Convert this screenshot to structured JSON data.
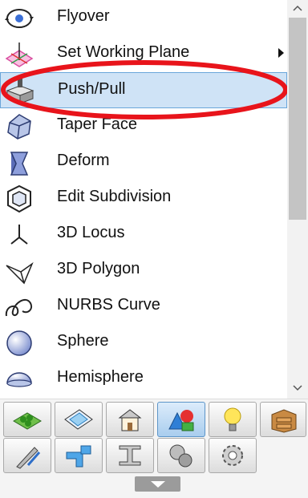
{
  "menu": {
    "items": [
      {
        "label": "Flyover",
        "icon": "flyover-icon"
      },
      {
        "label": "Set Working Plane",
        "icon": "working-plane-icon",
        "has_submenu": true
      },
      {
        "label": "Push/Pull",
        "icon": "push-pull-icon",
        "selected": true
      },
      {
        "label": "Taper Face",
        "icon": "taper-face-icon"
      },
      {
        "label": "Deform",
        "icon": "deform-icon"
      },
      {
        "label": "Edit Subdivision",
        "icon": "edit-subdivision-icon"
      },
      {
        "label": "3D Locus",
        "icon": "3d-locus-icon"
      },
      {
        "label": "3D Polygon",
        "icon": "3d-polygon-icon"
      },
      {
        "label": "NURBS Curve",
        "icon": "nurbs-curve-icon"
      },
      {
        "label": "Sphere",
        "icon": "sphere-icon"
      },
      {
        "label": "Hemisphere",
        "icon": "hemisphere-icon"
      }
    ]
  },
  "annotation": {
    "color": "#e8141b",
    "shape": "ellipse-highlight"
  },
  "toolbar": {
    "row1": [
      "site-tools-icon",
      "drafting-plane-icon",
      "building-tools-icon",
      "3d-modeling-icon",
      "lighting-icon",
      "objects-icon"
    ],
    "row2": [
      "edit-tools-icon",
      "plumbing-pipe-icon",
      "steel-beam-icon",
      "bolt-icon",
      "gear-icon"
    ],
    "active": "3d-modeling-icon",
    "expand_icon": "chevron-down-icon"
  },
  "colors": {
    "selection": "#cfe3f6",
    "selection_border": "#6aa6da"
  }
}
